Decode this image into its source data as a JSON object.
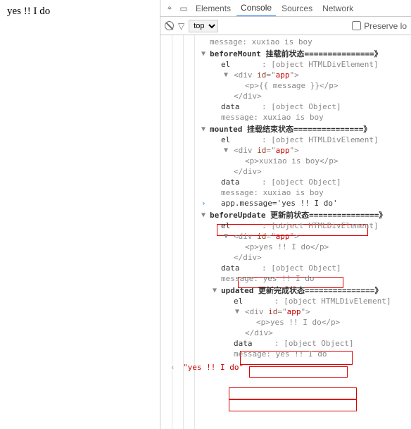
{
  "page_text": "yes !! I do",
  "tabs": {
    "inspect_icon": "⌖",
    "device_icon": "▭",
    "elements": "Elements",
    "console": "Console",
    "sources": "Sources",
    "network": "Network",
    "more": "…"
  },
  "filter": {
    "context": "top",
    "preserve_label": "Preserve lo"
  },
  "log": {
    "msg1": "message: xuxiao is boy",
    "beforeMount": {
      "title": "beforeMount 挂载前状态===============》",
      "el_label": "el",
      "el_val": ": [object HTMLDivElement]",
      "div_open": "<div id=\"app\">",
      "p": "<p>{{ message }}</p>",
      "div_close": "</div>",
      "data_label": "data",
      "data_val": ": [object Object]",
      "msg": "message: xuxiao is boy"
    },
    "mounted": {
      "title": "mounted 挂载结束状态===============》",
      "el_label": "el",
      "el_val": ": [object HTMLDivElement]",
      "div_open": "<div id=\"app\">",
      "p": "<p>xuxiao is boy</p>",
      "div_close": "</div>",
      "data_label": "data",
      "data_val": ": [object Object]",
      "msg": "message: xuxiao is boy"
    },
    "input": "app.message='yes !! I do'",
    "beforeUpdate": {
      "title": "beforeUpdate 更新前状态===============》",
      "el_label": "el",
      "el_val": ": [object HTMLDivElement]",
      "div_open": "<div id=\"app\">",
      "p": "<p>yes !! I do</p>",
      "div_close": "</div>",
      "data_label": "data",
      "data_val": ": [object Object]",
      "msg": "message: yes !! I do"
    },
    "updated": {
      "title": "updated 更新完成状态===============》",
      "el_label": "el",
      "el_val": ": [object HTMLDivElement]",
      "div_open": "<div id=\"app\">",
      "p": "<p>yes !! I do</p>",
      "div_close": "</div>",
      "data_label": "data",
      "data_val": ": [object Object]",
      "msg": "message: yes !! I do"
    },
    "return": "\"yes !! I do\""
  }
}
